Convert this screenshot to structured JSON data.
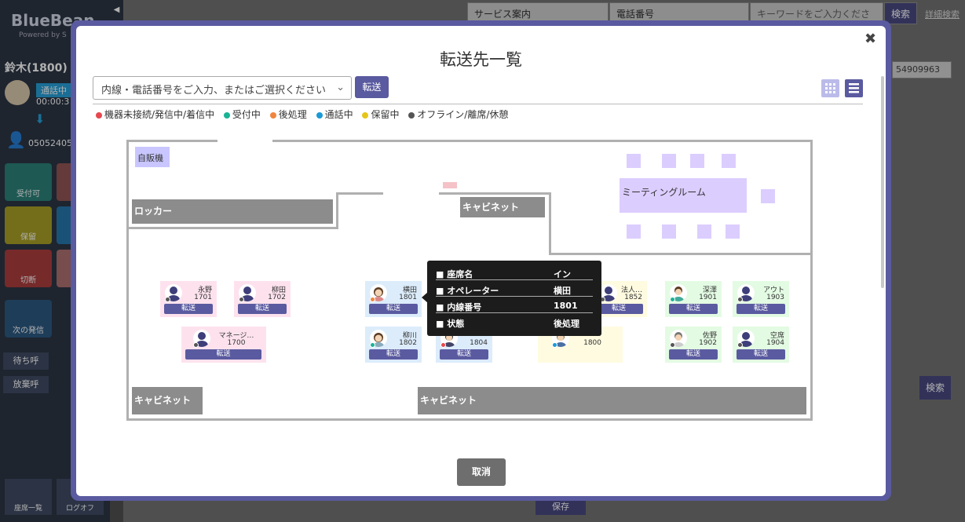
{
  "sidebar": {
    "brand": "BlueBean",
    "brand_sub": "Powered by S",
    "user": "鈴木(1800)",
    "status_badge": "通話中",
    "call_time": "00:00:3",
    "phone": "05052405",
    "tiles": [
      "受付可",
      "保留",
      "切断",
      "次の発信"
    ],
    "buttons": [
      "待ち呼",
      "放棄呼"
    ],
    "bottom_seats": "座席一覧",
    "bottom_logoff": "ログオフ"
  },
  "background": {
    "service_select": "サービス案内",
    "phone_select": "電話番号",
    "keyword_placeholder": "キーワードをご入力くださ",
    "search_label": "検索",
    "detail_search": "詳細検索",
    "number_select": "54909963",
    "search2_label": "検索",
    "save_label": "保存"
  },
  "modal": {
    "title": "転送先一覧",
    "close_icon": "close-icon",
    "search_placeholder": "内線・電話番号をご入力、またはご選択ください",
    "transfer_label": "転送",
    "cancel_label": "取消"
  },
  "legend": [
    {
      "label": "機器未接続/発信中/着信中",
      "color": "#e8474e"
    },
    {
      "label": "受付中",
      "color": "#1ab394"
    },
    {
      "label": "後処理",
      "color": "#f0853f"
    },
    {
      "label": "通話中",
      "color": "#1a9ad6"
    },
    {
      "label": "保留中",
      "color": "#e6c51a"
    },
    {
      "label": "オフライン/離席/休憩",
      "color": "#555555"
    }
  ],
  "floor": {
    "vending": "自販機",
    "locker": "ロッカー",
    "cabinet_top": "キャビネット",
    "meeting_room": "ミーティングルーム",
    "cabinet_bottom_left": "キャビネット",
    "cabinet_bottom_right": "キャビネット"
  },
  "seats": [
    {
      "name": "永野",
      "ext": "1701",
      "bg": "#fde2ee",
      "dot": "#555555",
      "button": "転送"
    },
    {
      "name": "柳田",
      "ext": "1702",
      "bg": "#fde2ee",
      "dot": "#555555",
      "button": "転送"
    },
    {
      "name": "マネージ…",
      "ext": "1700",
      "bg": "#fde2ee",
      "dot": "#555555",
      "button": "転送"
    },
    {
      "name": "横田",
      "ext": "1801",
      "bg": "#dcecfb",
      "dot": "#f0853f",
      "button": "転送"
    },
    {
      "name": "柳川",
      "ext": "1802",
      "bg": "#dcecfb",
      "dot": "#1ab394",
      "button": "転送"
    },
    {
      "name": "",
      "ext": "1804",
      "bg": "#dcecfb",
      "dot": "#e8474e",
      "button": "転送"
    },
    {
      "name": "法人…",
      "ext": "1852",
      "bg": "#fffbe0",
      "dot": "#555555",
      "button": "転送"
    },
    {
      "name": "",
      "ext": "1800",
      "bg": "#fffbe0",
      "dot": "#1a9ad6",
      "button": ""
    },
    {
      "name": "深澤",
      "ext": "1901",
      "bg": "#e3fbe3",
      "dot": "#1ab394",
      "button": "転送"
    },
    {
      "name": "アウト",
      "ext": "1903",
      "bg": "#e3fbe3",
      "dot": "#555555",
      "button": "転送"
    },
    {
      "name": "佐野",
      "ext": "1902",
      "bg": "#e3fbe3",
      "dot": "#555555",
      "button": "転送"
    },
    {
      "name": "空席",
      "ext": "1904",
      "bg": "#e3fbe3",
      "dot": "#555555",
      "button": "転送"
    }
  ],
  "tooltip": {
    "rows": [
      {
        "label": "■ 座席名",
        "value": "イン"
      },
      {
        "label": "■ オペレーター",
        "value": "横田"
      },
      {
        "label": "■ 内線番号",
        "value": "1801"
      },
      {
        "label": "■ 状態",
        "value": "後処理"
      }
    ]
  }
}
